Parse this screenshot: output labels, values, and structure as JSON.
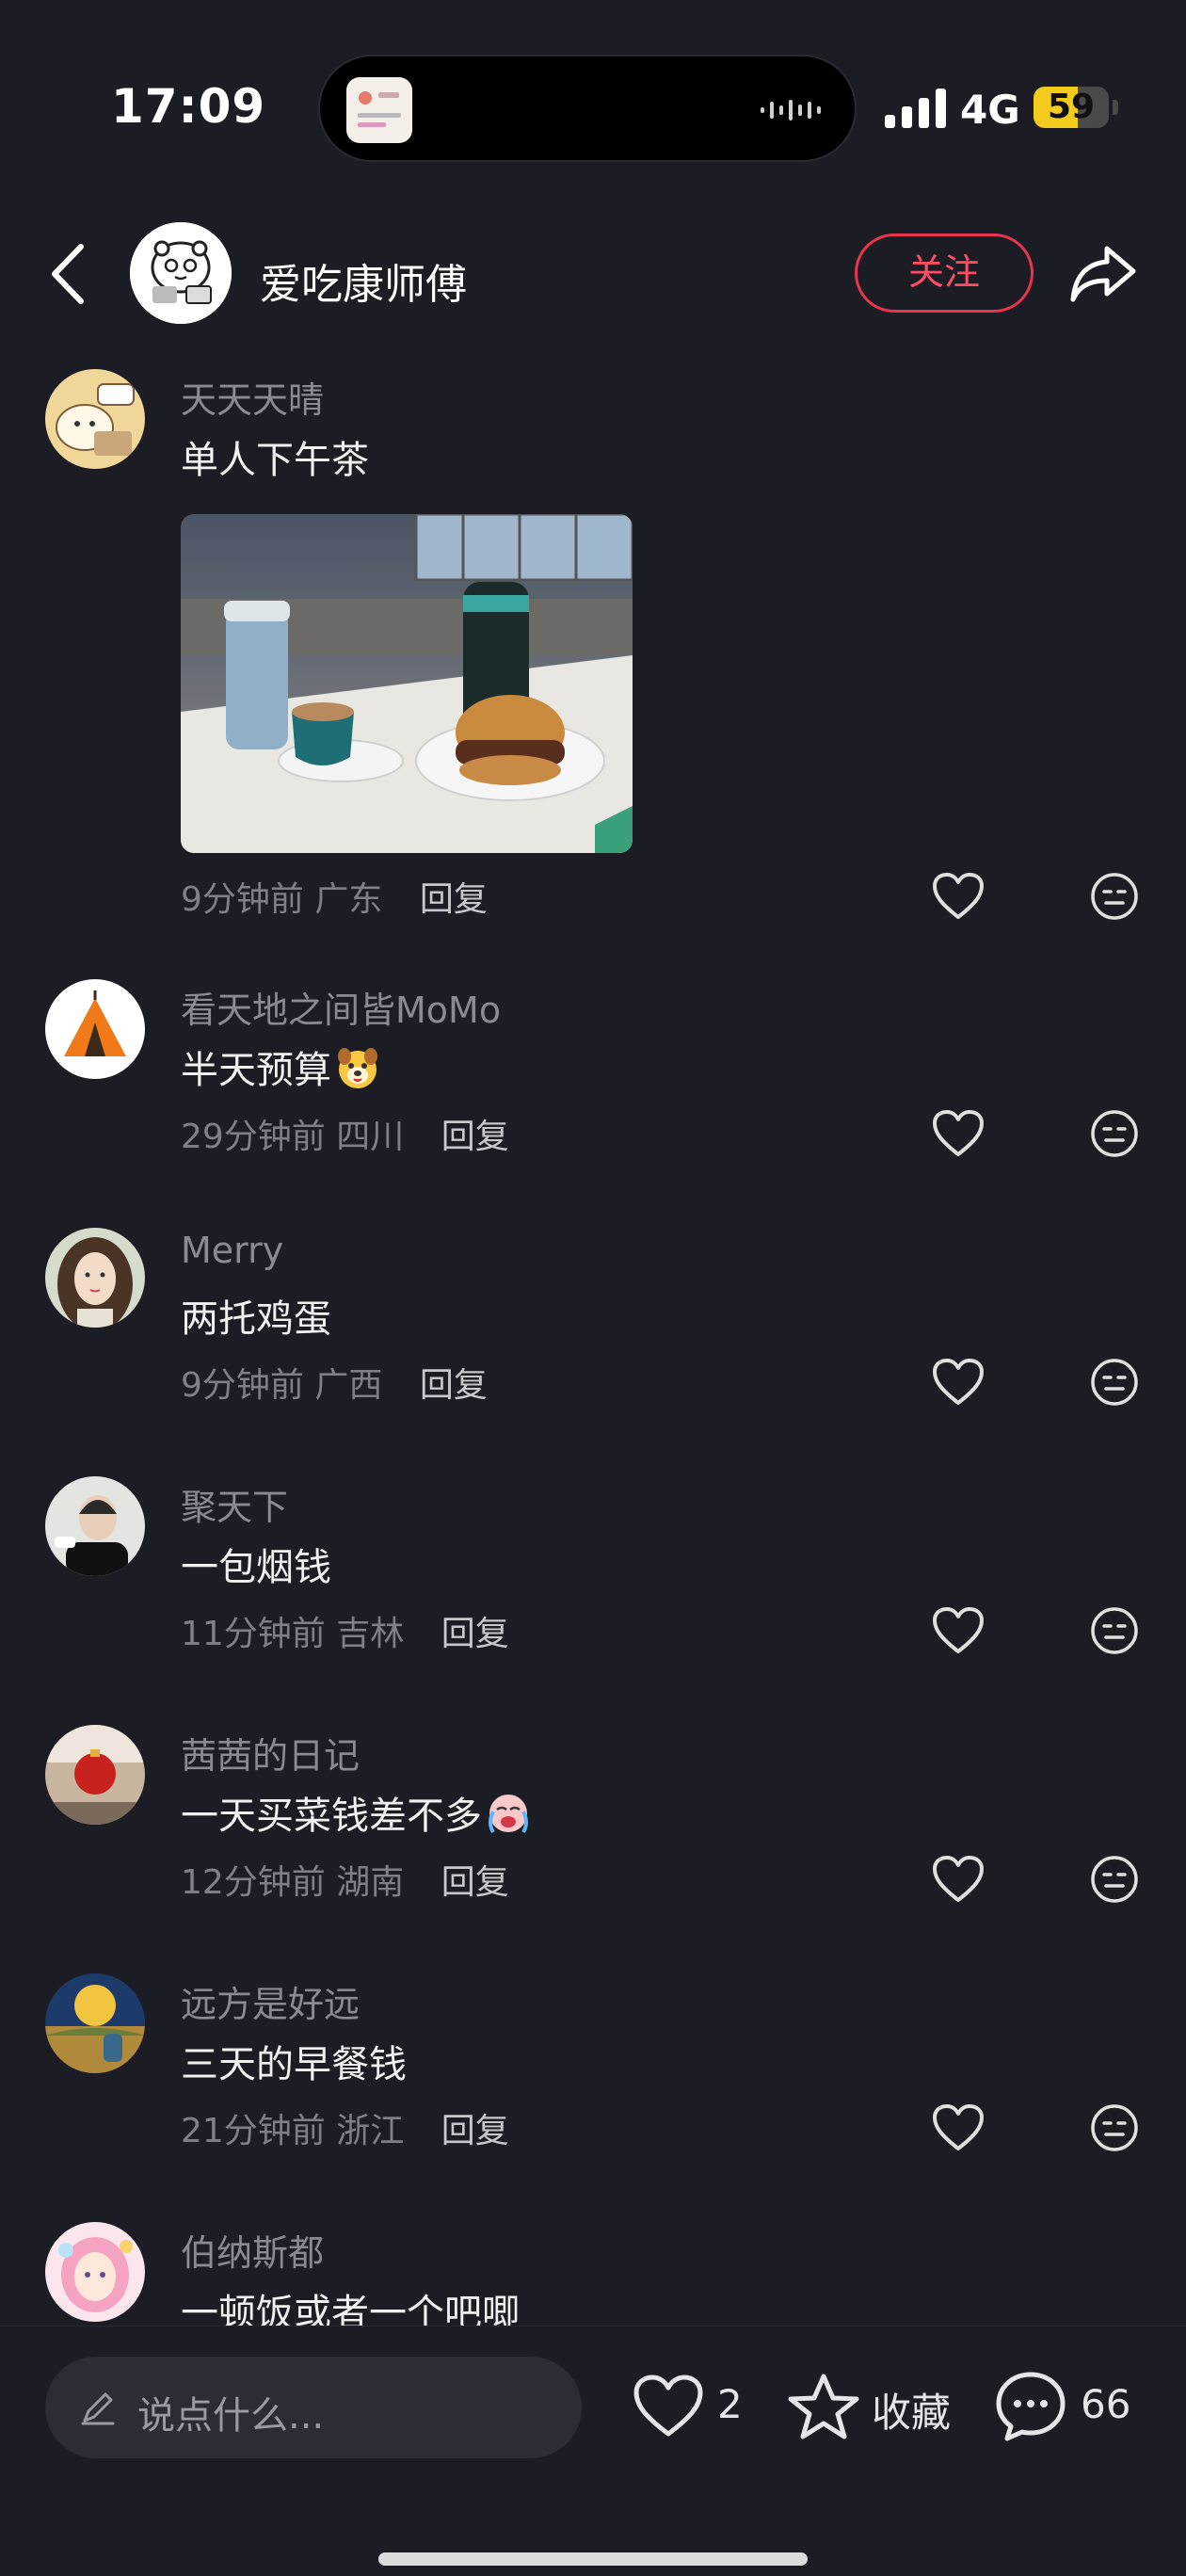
{
  "status_bar": {
    "time": "17:09",
    "network": "4G",
    "battery": "59",
    "battery_level_percent": 59
  },
  "header": {
    "author_name": "爱吃康师傅",
    "follow_label": "关注"
  },
  "comments": [
    {
      "user": "天天天晴",
      "text": "单人下午茶",
      "has_photo": true,
      "time": "9分钟前",
      "region": "广东",
      "reply_label": "回复"
    },
    {
      "user": "看天地之间皆MoMo",
      "text": "半天预算",
      "emoji": "dog-emoji",
      "time": "29分钟前",
      "region": "四川",
      "reply_label": "回复"
    },
    {
      "user": "Merry",
      "text": "两托鸡蛋",
      "time": "9分钟前",
      "region": "广西",
      "reply_label": "回复"
    },
    {
      "user": "聚天下",
      "text": "一包烟钱",
      "time": "11分钟前",
      "region": "吉林",
      "reply_label": "回复"
    },
    {
      "user": "茜茜的日记",
      "text": "一天买菜钱差不多",
      "emoji": "crying-emoji",
      "time": "12分钟前",
      "region": "湖南",
      "reply_label": "回复"
    },
    {
      "user": "远方是好远",
      "text": "三天的早餐钱",
      "time": "21分钟前",
      "region": "浙江",
      "reply_label": "回复"
    },
    {
      "user": "伯纳斯都",
      "text": "一顿饭或者一个吧唧"
    }
  ],
  "bottom_bar": {
    "input_placeholder": "说点什么...",
    "like_count": "2",
    "favorite_label": "收藏",
    "comment_count": "66"
  },
  "colors": {
    "background": "#1c1c24",
    "accent_red": "#e8344c",
    "battery_yellow": "#f2cb1d"
  }
}
